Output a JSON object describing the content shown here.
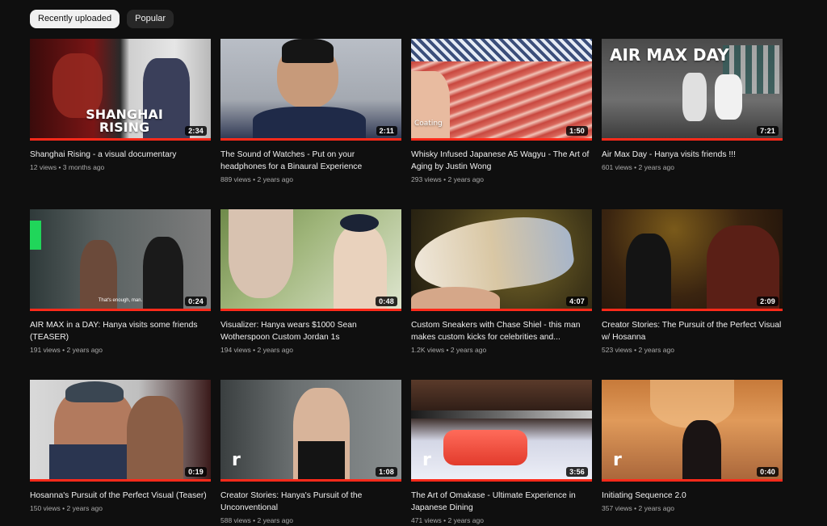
{
  "chips": [
    {
      "label": "Recently uploaded",
      "active": true
    },
    {
      "label": "Popular",
      "active": false
    }
  ],
  "videos": [
    {
      "title": "Shanghai Rising - a visual documentary",
      "views": "12 views",
      "age": "3 months ago",
      "duration": "2:34",
      "overlay": "SHANGHAI RISING"
    },
    {
      "title": "The Sound of Watches - Put on your headphones for a Binaural Experience",
      "views": "889 views",
      "age": "2 years ago",
      "duration": "2:11"
    },
    {
      "title": "Whisky Infused Japanese A5 Wagyu - The Art of Aging by Justin Wong",
      "views": "293 views",
      "age": "2 years ago",
      "duration": "1:50",
      "overlay": "Coating"
    },
    {
      "title": "Air Max Day - Hanya visits friends !!!",
      "views": "601 views",
      "age": "2 years ago",
      "duration": "7:21",
      "overlay": "AIR MAX DAY"
    },
    {
      "title": "AIR MAX in a DAY: Hanya visits some friends (TEASER)",
      "views": "191 views",
      "age": "2 years ago",
      "duration": "0:24",
      "overlay": "That's enough, man."
    },
    {
      "title": "Visualizer: Hanya wears $1000 Sean Wotherspoon Custom Jordan 1s",
      "views": "194 views",
      "age": "2 years ago",
      "duration": "0:48"
    },
    {
      "title": "Custom Sneakers with Chase Shiel - this man makes custom kicks for celebrities and...",
      "views": "1.2K views",
      "age": "2 years ago",
      "duration": "4:07"
    },
    {
      "title": "Creator Stories: The Pursuit of the Perfect Visual w/ Hosanna",
      "views": "523 views",
      "age": "2 years ago",
      "duration": "2:09"
    },
    {
      "title": "Hosanna's Pursuit of the Perfect Visual (Teaser)",
      "views": "150 views",
      "age": "2 years ago",
      "duration": "0:19"
    },
    {
      "title": "Creator Stories: Hanya's Pursuit of the Unconventional",
      "views": "588 views",
      "age": "2 years ago",
      "duration": "1:08",
      "overlay": "r"
    },
    {
      "title": "The Art of Omakase - Ultimate Experience in Japanese Dining",
      "views": "471 views",
      "age": "2 years ago",
      "duration": "3:56",
      "overlay": "r"
    },
    {
      "title": "Initiating Sequence 2.0",
      "views": "357 views",
      "age": "2 years ago",
      "duration": "0:40",
      "overlay": "r"
    }
  ],
  "colors": {
    "progress": "#ff2a1a",
    "background": "#0f0f0f"
  }
}
